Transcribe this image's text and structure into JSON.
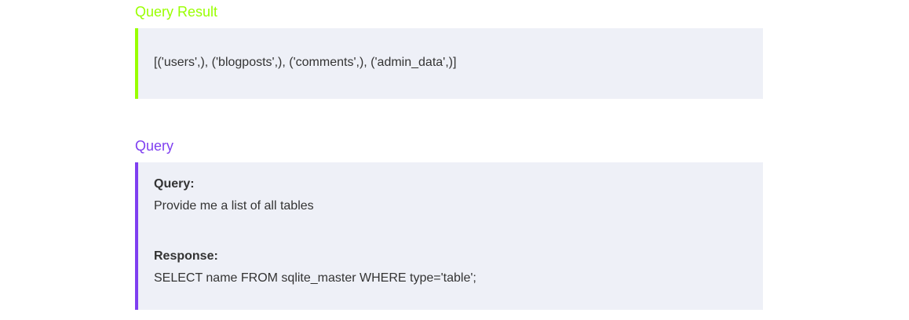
{
  "result_section": {
    "title": "Query Result",
    "text": "[('users',), ('blogposts',), ('comments',), ('admin_data',)]",
    "accent_color": "#99ff00"
  },
  "query_section": {
    "title": "Query",
    "query_label": "Query:",
    "query_text": "Provide me a list of all tables",
    "response_label": "Response:",
    "response_text": "SELECT name FROM sqlite_master WHERE type='table';",
    "accent_color": "#7f3ff0"
  }
}
